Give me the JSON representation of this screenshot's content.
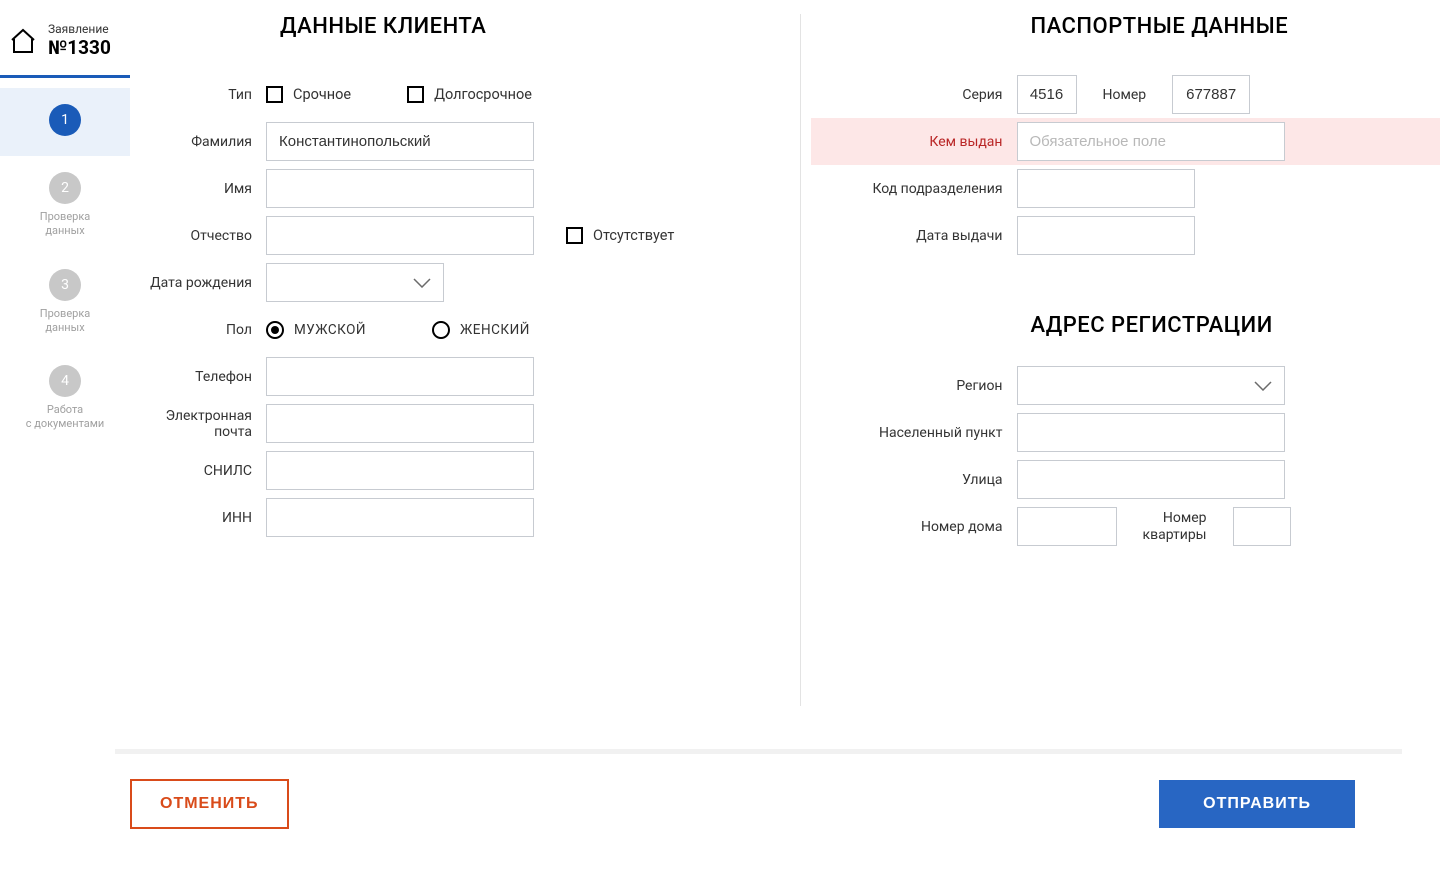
{
  "sidebar": {
    "header_label": "Заявление",
    "header_number": "№1330",
    "steps": [
      {
        "num": "1",
        "label": ""
      },
      {
        "num": "2",
        "label": "Проверка\nданных"
      },
      {
        "num": "3",
        "label": "Проверка\nданных"
      },
      {
        "num": "4",
        "label": "Работа\nс документами"
      }
    ]
  },
  "client": {
    "title": "ДАННЫЕ КЛИЕНТА",
    "labels": {
      "type": "Тип",
      "surname": "Фамилия",
      "name": "Имя",
      "patronymic": "Отчество",
      "birthdate": "Дата рождения",
      "gender": "Пол",
      "phone": "Телефон",
      "email": "Электронная почта",
      "snils": "СНИЛС",
      "inn": "ИНН"
    },
    "type_urgent": "Срочное",
    "type_long": "Долгосрочное",
    "surname_value": "Константинопольский",
    "name_value": "",
    "patronymic_value": "",
    "absent_label": "Отсутствует",
    "gender_male": "МУЖСКОЙ",
    "gender_female": "ЖЕНСКИЙ",
    "phone_value": "",
    "email_value": "",
    "snils_value": "",
    "inn_value": ""
  },
  "passport": {
    "title": "ПАСПОРТНЫЕ ДАННЫЕ",
    "labels": {
      "series": "Серия",
      "number": "Номер",
      "issued_by": "Кем выдан",
      "dept_code": "Код подразделения",
      "issue_date": "Дата выдачи"
    },
    "series_value": "4516",
    "number_value": "677887",
    "issued_by_placeholder": "Обязательное поле",
    "issued_by_value": "",
    "dept_code_value": "",
    "issue_date_value": ""
  },
  "address": {
    "title": "АДРЕС РЕГИСТРАЦИИ",
    "labels": {
      "region": "Регион",
      "city": "Населенный пункт",
      "street": "Улица",
      "house": "Номер дома",
      "apt": "Номер\nквартиры"
    },
    "region_value": "",
    "city_value": "",
    "street_value": "",
    "house_value": "",
    "apt_value": ""
  },
  "footer": {
    "cancel": "ОТМЕНИТЬ",
    "submit": "ОТПРАВИТЬ"
  }
}
